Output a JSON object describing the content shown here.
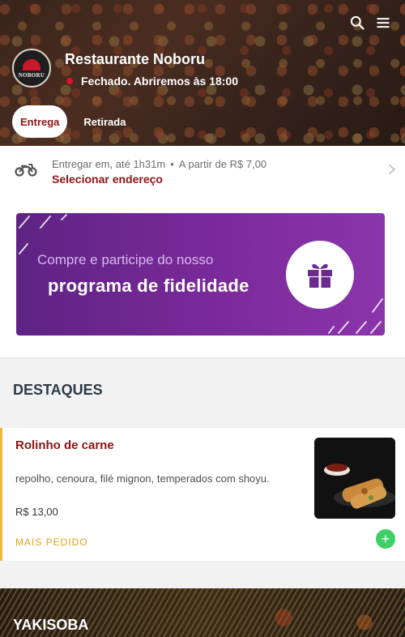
{
  "header": {
    "restaurant_name": "Restaurante Noboru",
    "status_text": "Fechado. Abriremos às 18:00",
    "logo_text": "NOBORU",
    "tabs": [
      {
        "label": "Entrega",
        "active": true
      },
      {
        "label": "Retirada",
        "active": false
      }
    ],
    "icons": [
      "search-icon",
      "menu-icon"
    ]
  },
  "delivery": {
    "prefix": "Entregar em, até 1h31m",
    "separator": "•",
    "min_price": "A partir de R$ 7,00",
    "select_address": "Selecionar endereço",
    "icon": "motorcycle-icon"
  },
  "banner": {
    "line1": "Compre e participe do nosso",
    "line2": "programa de fidelidade",
    "icon": "gift-icon"
  },
  "highlights": {
    "title": "DESTAQUES",
    "items": [
      {
        "name": "Rolinho de carne",
        "description": "repolho, cenoura, filé mignon, temperados com shoyu.",
        "price": "R$ 13,00",
        "badge": "MAIS PEDIDO",
        "add_symbol": "+"
      }
    ]
  },
  "next_section": {
    "title": "YAKISOBA"
  },
  "colors": {
    "brand": "#8c1414",
    "status_closed": "#e0102a",
    "badge": "#e0a021",
    "add_button": "#3ecf66",
    "banner_purple": "#7a2a9a"
  }
}
